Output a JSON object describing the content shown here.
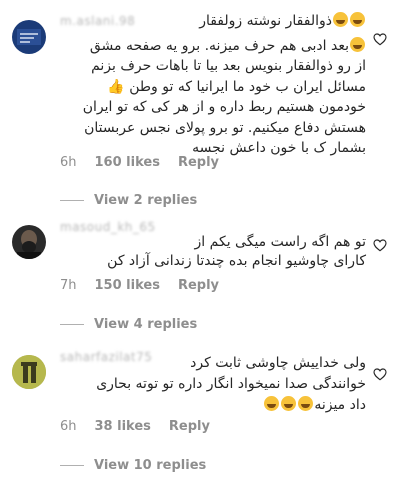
{
  "comments": [
    {
      "username": "m.aslani.98",
      "lines": [
        "ذوالفقار نوشته زولفقار",
        "بعد ادبی هم حرف میزنه. برو یه صفحه مشق",
        "از رو ذوالفقار بنویس بعد بیا تا باهات حرف بزنم",
        "مسائل ایران ب خود ما ایرانیا که تو وطن",
        "خودمون هستیم ربط داره و از هر کی که تو ایران",
        "هستش دفاع میکنیم. تو برو پولای نجس عربستان",
        "بشمار ک با خون داعش نجسه"
      ],
      "time": "6h",
      "likes": "160 likes",
      "reply": "Reply",
      "view_replies": "View 2 replies"
    },
    {
      "username": "masoud_kh_65",
      "lines": [
        "تو هم اگه راست میگی یکم از",
        "کارای چاوشیو انجام بده چندتا زندانی آزاد کن"
      ],
      "time": "7h",
      "likes": "150 likes",
      "reply": "Reply",
      "view_replies": "View 4 replies"
    },
    {
      "username": "saharfazilat75",
      "lines": [
        "ولی خداییش چاوشی ثابت کرد",
        "خوانندگی صدا نمیخواد انگار داره تو توته بحاری",
        "داد میزنه"
      ],
      "time": "6h",
      "likes": "38 likes",
      "reply": "Reply",
      "view_replies": "View 10 replies"
    }
  ],
  "icons": {
    "heart": "heart-outline-icon",
    "emoji": "rolling-laughing-face",
    "thumb": "thumbs-up"
  },
  "colors": {
    "text": "#262626",
    "meta": "#8e8e8e",
    "username": "#b8b8b8"
  }
}
